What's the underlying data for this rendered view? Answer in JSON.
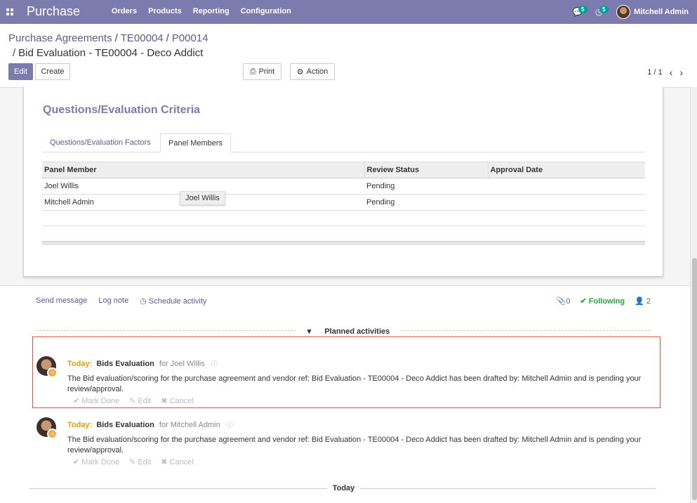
{
  "navbar": {
    "brand": "Purchase",
    "menu": [
      "Orders",
      "Products",
      "Reporting",
      "Configuration"
    ],
    "messages_count": "5",
    "activities_count": "5",
    "user_name": "Mitchell Admin"
  },
  "breadcrumb": {
    "items": [
      "Purchase Agreements",
      "TE00004",
      "P00014"
    ],
    "current": "Bid Evaluation - TE00004 - Deco Addict"
  },
  "buttons": {
    "edit": "Edit",
    "create": "Create",
    "print": "Print",
    "action": "Action"
  },
  "pager": {
    "value": "1 / 1"
  },
  "form": {
    "section_title": "Questions/Evaluation Criteria",
    "tabs": [
      "Questions/Evaluation Factors",
      "Panel Members"
    ],
    "active_tab": "Panel Members",
    "table": {
      "columns": [
        "Panel Member",
        "Review Status",
        "Approval Date"
      ],
      "rows": [
        [
          "Joel Willis",
          "Pending",
          ""
        ],
        [
          "Mitchell Admin",
          "Pending",
          ""
        ]
      ]
    },
    "tooltip": "Joel Willis"
  },
  "chatter": {
    "send_message": "Send message",
    "log_note": "Log note",
    "schedule_activity": "Schedule activity",
    "attachments_count": "0",
    "following": "Following",
    "followers_count": "2",
    "planned_label": "Planned activities",
    "today_label": "Today",
    "activities": [
      {
        "when": "Today:",
        "title": "Bids Evaluation",
        "for": "for Joel Willis",
        "body": "The Bid evaluation/scoring for the purchase agreement and vendor ref: Bid Evaluation - TE00004 - Deco Addict has been drafted by: Mitchell Admin and is pending your review/approval.",
        "mark_done": "Mark Done",
        "edit": "Edit",
        "cancel": "Cancel"
      },
      {
        "when": "Today:",
        "title": "Bids Evaluation",
        "for": "for Mitchell Admin",
        "body": "The Bid evaluation/scoring for the purchase agreement and vendor ref: Bid Evaluation - TE00004 - Deco Addict has been drafted by: Mitchell Admin and is pending your review/approval.",
        "mark_done": "Mark Done",
        "edit": "Edit",
        "cancel": "Cancel"
      }
    ]
  },
  "colors": {
    "brand": "#7c7bad",
    "highlight": "#e8503a",
    "today": "#e1a000",
    "following": "#28a745"
  }
}
